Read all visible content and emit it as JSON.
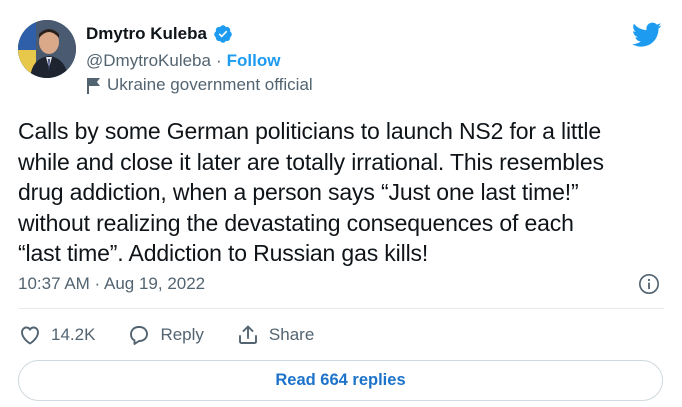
{
  "author": {
    "name": "Dmytro Kuleba",
    "handle": "@DmytroKuleba",
    "separator": "·",
    "follow_label": "Follow",
    "label": "Ukraine government official"
  },
  "tweet": {
    "text": "Calls by some German politicians to launch NS2 for a little\nwhile and close it later are totally irrational. This resembles\ndrug addiction, when a person says “Just one last time!”\nwithout realizing the devastating consequences of each\n“last time”. Addiction to Russian gas kills!",
    "timestamp": "10:37 AM · Aug 19, 2022"
  },
  "actions": {
    "like_count": "14.2K",
    "reply_label": "Reply",
    "share_label": "Share"
  },
  "replies_button": "Read 664 replies",
  "colors": {
    "accent": "#1d9bf0",
    "text": "#0f1419",
    "muted": "#536471"
  }
}
